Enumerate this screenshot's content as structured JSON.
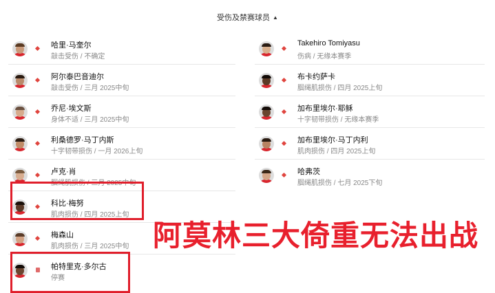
{
  "header": {
    "title": "受伤及禁赛球员",
    "caret": "▲"
  },
  "left_players": [
    {
      "name": "哈里·马奎尔",
      "status": "敲击受伤 / 不确定",
      "marker": "diamond",
      "skin": "#c99a7a",
      "hair": "#5a3a22"
    },
    {
      "name": "阿尔泰巴音迪尔",
      "status": "敲击受伤 / 三月 2025中旬",
      "marker": "diamond",
      "skin": "#b98a6a",
      "hair": "#2a1a10"
    },
    {
      "name": "乔尼·埃文斯",
      "status": "身体不适 / 三月 2025中旬",
      "marker": "diamond",
      "skin": "#d7ab8c",
      "hair": "#6b5140"
    },
    {
      "name": "利桑德罗·马丁内斯",
      "status": "十字韧带损伤 / 一月 2026上旬",
      "marker": "diamond",
      "skin": "#c08c68",
      "hair": "#2b1c12"
    },
    {
      "name": "卢克·肖",
      "status": "腘绳肌损伤 / 三月 2025中旬",
      "marker": "diamond",
      "skin": "#d8ad8f",
      "hair": "#7a5a3e"
    },
    {
      "name": "科比·梅努",
      "status": "肌肉损伤 / 四月 2025上旬",
      "marker": "diamond",
      "skin": "#5a3a28",
      "hair": "#1a100a"
    },
    {
      "name": "梅森山",
      "status": "肌肉损伤 / 三月 2025中旬",
      "marker": "diamond",
      "skin": "#d2a283",
      "hair": "#5a3c28"
    },
    {
      "name": "帕特里克·多尔古",
      "status": "停赛",
      "marker": "square",
      "skin": "#6b4630",
      "hair": "#140c08"
    }
  ],
  "right_players": [
    {
      "name": "Takehiro Tomiyasu",
      "status": "伤病 / 无缘本赛季",
      "marker": "diamond",
      "skin": "#d9b08e",
      "hair": "#2a1c14"
    },
    {
      "name": "布卡约萨卡",
      "status": "腘绳肌损伤 / 四月 2025上旬",
      "marker": "diamond",
      "skin": "#5b3a26",
      "hair": "#120a06"
    },
    {
      "name": "加布里埃尔·耶稣",
      "status": "十字韧带损伤 / 无缘本赛季",
      "marker": "diamond",
      "skin": "#6a452e",
      "hair": "#140c08"
    },
    {
      "name": "加布里埃尔·马丁内利",
      "status": "肌肉损伤 / 四月 2025上旬",
      "marker": "diamond",
      "skin": "#b88362",
      "hair": "#2a1a10"
    },
    {
      "name": "哈弗茨",
      "status": "腘绳肌损伤 / 七月 2025下旬",
      "marker": "diamond",
      "skin": "#d3a688",
      "hair": "#3a2818"
    }
  ],
  "overlay_caption": "阿莫林三大倚重无法出战",
  "colors": {
    "highlight": "#e01e2b",
    "marker": "#e0443e",
    "caption": "#e8202d"
  }
}
